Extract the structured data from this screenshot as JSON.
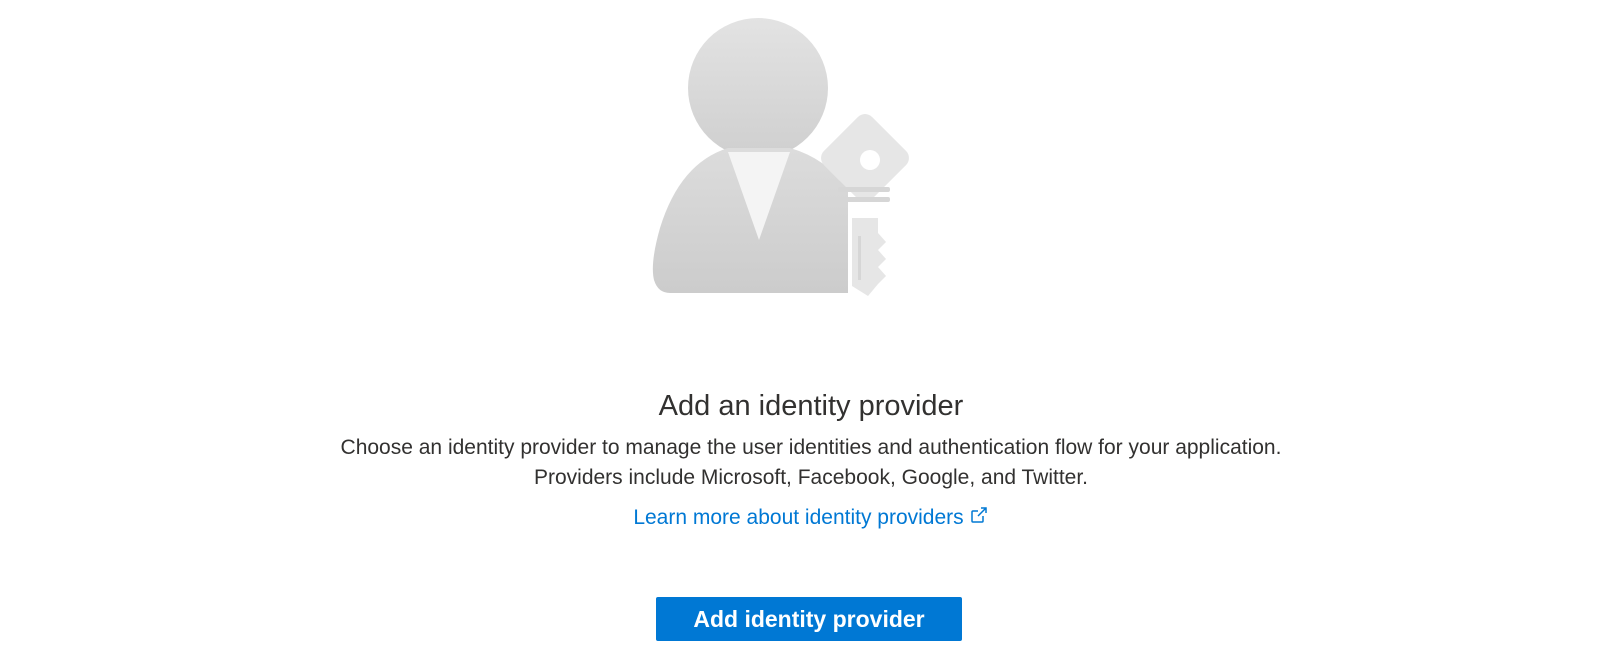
{
  "empty_state": {
    "illustration": "user-with-key-icon",
    "title": "Add an identity provider",
    "description_line1": "Choose an identity provider to manage the user identities and authentication flow for your application.",
    "description_line2": "Providers include Microsoft, Facebook, Google, and Twitter.",
    "learn_more_label": "Learn more about identity providers",
    "learn_more_icon": "external-link-icon",
    "button_label": "Add identity provider"
  },
  "colors": {
    "accent": "#0078d4",
    "text": "#323130",
    "illustration_gray": "#d2d2d2"
  }
}
